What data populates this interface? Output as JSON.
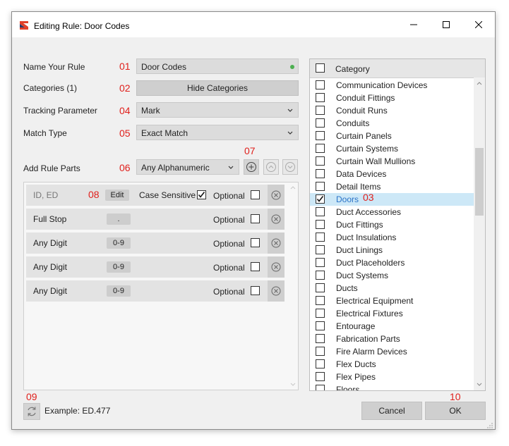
{
  "window": {
    "title": "Editing Rule: Door Codes"
  },
  "form": {
    "name_label": "Name Your Rule",
    "name_value": "Door Codes",
    "categories_label": "Categories (1)",
    "hide_categories_label": "Hide Categories",
    "tracking_label": "Tracking Parameter",
    "tracking_value": "Mark",
    "match_label": "Match Type",
    "match_value": "Exact Match",
    "add_parts_label": "Add Rule Parts",
    "add_parts_value": "Any Alphanumeric"
  },
  "callouts": [
    "01",
    "02",
    "03",
    "04",
    "05",
    "06",
    "07",
    "08",
    "09",
    "10"
  ],
  "rule_parts": [
    {
      "label": "ID, ED",
      "pill": "Edit",
      "case_sensitive_label": "Case Sensitive",
      "case_sensitive": true,
      "optional_label": "Optional",
      "optional": false
    },
    {
      "label": "Full Stop",
      "pill": ".",
      "optional_label": "Optional",
      "optional": false
    },
    {
      "label": "Any Digit",
      "pill": "0-9",
      "optional_label": "Optional",
      "optional": false
    },
    {
      "label": "Any Digit",
      "pill": "0-9",
      "optional_label": "Optional",
      "optional": false
    },
    {
      "label": "Any Digit",
      "pill": "0-9",
      "optional_label": "Optional",
      "optional": false
    }
  ],
  "categories": {
    "header": "Category",
    "items": [
      {
        "label": "Communication Devices",
        "checked": false
      },
      {
        "label": "Conduit Fittings",
        "checked": false
      },
      {
        "label": "Conduit Runs",
        "checked": false
      },
      {
        "label": "Conduits",
        "checked": false
      },
      {
        "label": "Curtain Panels",
        "checked": false
      },
      {
        "label": "Curtain Systems",
        "checked": false
      },
      {
        "label": "Curtain Wall Mullions",
        "checked": false
      },
      {
        "label": "Data Devices",
        "checked": false
      },
      {
        "label": "Detail Items",
        "checked": false
      },
      {
        "label": "Doors",
        "checked": true
      },
      {
        "label": "Duct Accessories",
        "checked": false
      },
      {
        "label": "Duct Fittings",
        "checked": false
      },
      {
        "label": "Duct Insulations",
        "checked": false
      },
      {
        "label": "Duct Linings",
        "checked": false
      },
      {
        "label": "Duct Placeholders",
        "checked": false
      },
      {
        "label": "Duct Systems",
        "checked": false
      },
      {
        "label": "Ducts",
        "checked": false
      },
      {
        "label": "Electrical Equipment",
        "checked": false
      },
      {
        "label": "Electrical Fixtures",
        "checked": false
      },
      {
        "label": "Entourage",
        "checked": false
      },
      {
        "label": "Fabrication Parts",
        "checked": false
      },
      {
        "label": "Fire Alarm Devices",
        "checked": false
      },
      {
        "label": "Flex Ducts",
        "checked": false
      },
      {
        "label": "Flex Pipes",
        "checked": false
      },
      {
        "label": "Floors",
        "checked": false
      }
    ]
  },
  "footer": {
    "example_text": "Example: ED.477",
    "cancel_label": "Cancel",
    "ok_label": "OK"
  },
  "colors": {
    "callout": "#e0201c",
    "selected_row": "#cde8f7",
    "selected_text": "#2a73c8",
    "status_dot": "#4caf50"
  }
}
